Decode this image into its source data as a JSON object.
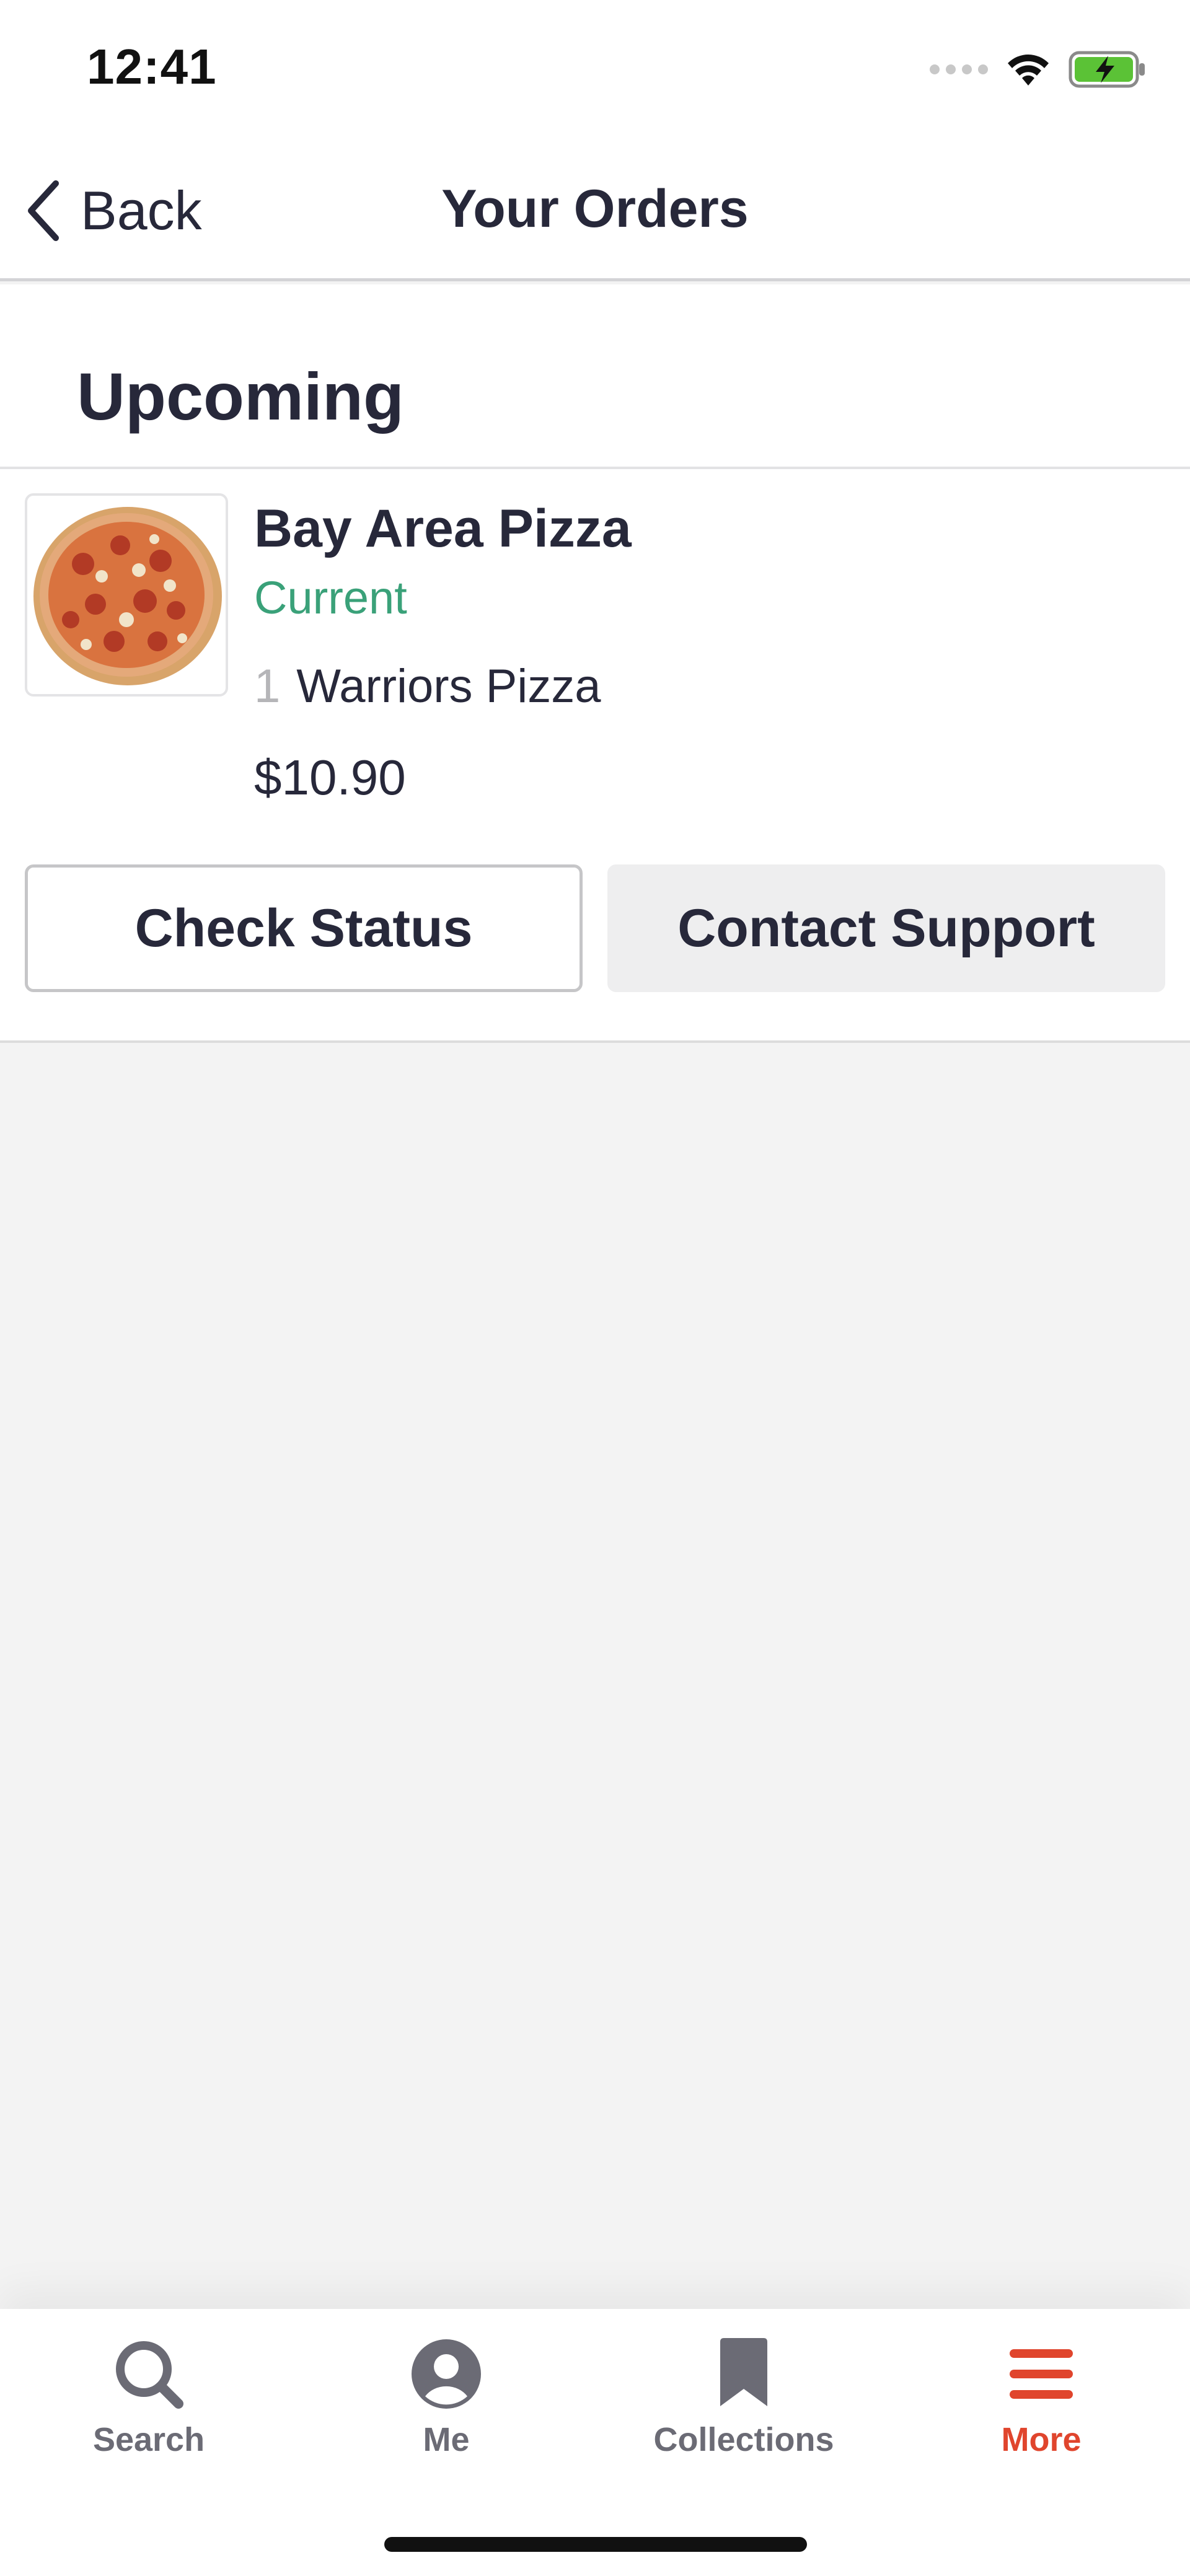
{
  "status_bar": {
    "time": "12:41",
    "icons": [
      "signal-dots-icon",
      "wifi-icon",
      "battery-charging-icon"
    ]
  },
  "nav": {
    "back_label": "Back",
    "title": "Your Orders"
  },
  "section": {
    "title": "Upcoming"
  },
  "order": {
    "restaurant": "Bay Area Pizza",
    "status": "Current",
    "item_qty": "1",
    "item_name": "Warriors Pizza",
    "price": "$10.90",
    "thumbnail": "pizza-image"
  },
  "actions": {
    "check_status": "Check Status",
    "contact_support": "Contact Support"
  },
  "tabs": [
    {
      "label": "Search",
      "icon": "search-icon",
      "active": false
    },
    {
      "label": "Me",
      "icon": "user-icon",
      "active": false
    },
    {
      "label": "Collections",
      "icon": "bookmark-icon",
      "active": false
    },
    {
      "label": "More",
      "icon": "menu-icon",
      "active": true
    }
  ],
  "colors": {
    "accent": "#e0452d",
    "status_green": "#3aa179",
    "text": "#27283a",
    "tab_inactive": "#6b6b75"
  }
}
